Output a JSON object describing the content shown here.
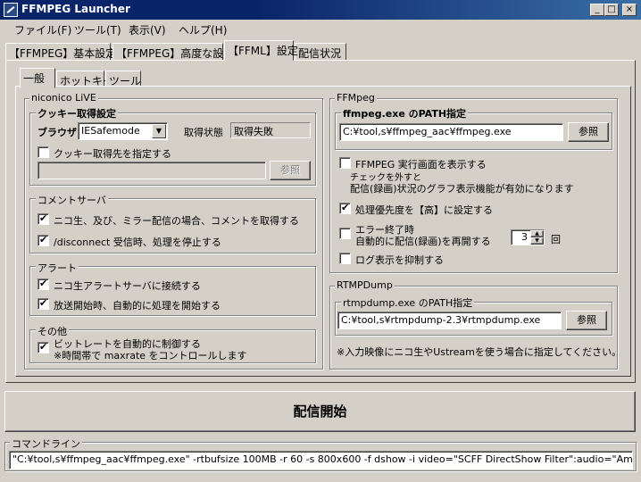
{
  "window": {
    "title": "FFMPEG Launcher",
    "min": "_",
    "max": "□",
    "close": "×"
  },
  "menu": [
    "ファイル(F)",
    "ツール(T)",
    "表示(V)",
    "ヘルプ(H)"
  ],
  "main_tabs": [
    "【FFMPEG】基本設定",
    "【FFMPEG】高度な設定",
    "【FFML】設定",
    "配信状況"
  ],
  "sub_tabs": [
    "一般",
    "ホットキー",
    "ツール"
  ],
  "niconico": {
    "group_title": "niconico LiVE",
    "cookie": {
      "title": "クッキー取得設定",
      "browser_label": "ブラウザ",
      "browser_value": "IESafemode",
      "status_label": "取得状態",
      "status_value": "取得失敗",
      "specify_label": "クッキー取得先を指定する",
      "path_value": "",
      "browse_label": "参照"
    },
    "comment": {
      "title": "コメントサーバ",
      "items": [
        {
          "label": "ニコ生、及び、ミラー配信の場合、コメントを取得する",
          "checked": true
        },
        {
          "label": "/disconnect 受信時、処理を停止する",
          "checked": true
        }
      ]
    },
    "alert": {
      "title": "アラート",
      "items": [
        {
          "label": "ニコ生アラートサーバに接続する",
          "checked": true
        },
        {
          "label": "放送開始時、自動的に処理を開始する",
          "checked": true
        }
      ]
    },
    "other": {
      "title": "その他",
      "line1": "ビットレートを自動的に制御する",
      "line2": "※時間帯で maxrate をコントロールします",
      "checked": true
    }
  },
  "ffmpeg": {
    "group_title": "FFMpeg",
    "path_title": "ffmpeg.exe のPATH指定",
    "path_value": "C:¥tool,s¥ffmpeg_aac¥ffmpeg.exe",
    "browse_label": "参照",
    "show_exec": {
      "label": "FFMPEG 実行画面を表示する",
      "checked": false
    },
    "show_exec_note1": "チェックを外すと",
    "show_exec_note2": "配信(録画)状況のグラフ表示機能が有効になります",
    "priority": {
      "label": "処理優先度を【高】に設定する",
      "checked": true
    },
    "restart": {
      "label1": "エラー終了時",
      "label2": "自動的に配信(録画)を再開する",
      "checked": false,
      "count": "3",
      "unit": "回"
    },
    "suppress_log": {
      "label": "ログ表示を抑制する",
      "checked": false
    }
  },
  "rtmpdump": {
    "group_title": "RTMPDump",
    "path_title": "rtmpdump.exe のPATH指定",
    "path_value": "C:¥tool,s¥rtmpdump-2.3¥rtmpdump.exe",
    "browse_label": "参照",
    "note": "※入力映像にニコ生やUstreamを使う場合に指定してください。"
  },
  "start_button": "配信開始",
  "cmdline": {
    "title": "コマンドライン",
    "value": "\"C:¥tool,s¥ffmpeg_aac¥ffmpeg.exe\" -rtbufsize 100MB -r 60 -s 800x600 -f dshow -i video=\"SCFF DirectShow Filter\":audio=\"AmaRec A"
  }
}
